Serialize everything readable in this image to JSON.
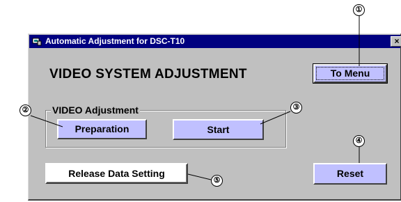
{
  "window": {
    "title": "Automatic Adjustment for DSC-T10",
    "close_glyph": "×"
  },
  "main": {
    "heading": "VIDEO SYSTEM ADJUSTMENT",
    "to_menu_label": "To Menu",
    "group": {
      "label": "VIDEO Adjustment",
      "preparation_label": "Preparation",
      "start_label": "Start"
    },
    "release_label": "Release Data Setting",
    "reset_label": "Reset"
  },
  "callouts": [
    "①",
    "②",
    "③",
    "④",
    "⑤"
  ],
  "icons": {
    "app": "app-icon",
    "close": "close-icon"
  },
  "colors": {
    "titlebar": "#000080",
    "window_face": "#c0c0c0",
    "button_lavender": "#c0c0ff",
    "button_white": "#ffffff"
  }
}
